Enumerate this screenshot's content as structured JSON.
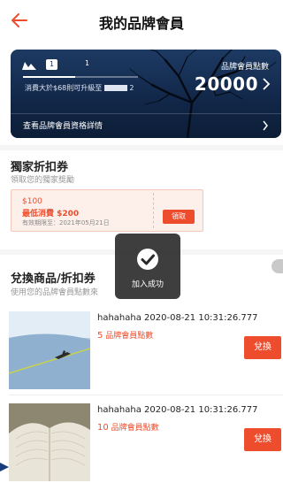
{
  "header": {
    "title": "我的品牌會員"
  },
  "member_card": {
    "level_badge": "1",
    "level_number": "1",
    "spend_note": "消費大於$68則可升級至",
    "spend_note_level": "2",
    "points_label": "品牌會員點數",
    "points_value": "20000",
    "details_link": "查看品牌會員資格詳情",
    "progress": 0.45
  },
  "discount_section": {
    "title": "獨家折扣券",
    "subtitle": "領取您的獨家獎勵",
    "coupon": {
      "amount": "$100",
      "min_spend": "最低消費 $200",
      "valid_until": "有效期限至：2021年05月21日",
      "claim_label": "領取"
    }
  },
  "redeem_section": {
    "title": "兌換商品/折扣券",
    "subtitle": "使用您的品牌會員點數來"
  },
  "items": [
    {
      "name": "hahahaha 2020-08-21 10:31:26.777",
      "points": "5",
      "points_unit": "品牌會員點數",
      "button": "兌換"
    },
    {
      "name": "hahahaha 2020-08-21 10:31:26.777",
      "points": "10",
      "points_unit": "品牌會員點數",
      "button": "兌換"
    }
  ],
  "toast": {
    "message": "加入成功"
  },
  "colors": {
    "accent": "#ee4d2d",
    "card": "#12284a"
  },
  "icons": {
    "back": "back-arrow-icon",
    "check": "check-icon",
    "chevron": "chevron-right-icon"
  }
}
